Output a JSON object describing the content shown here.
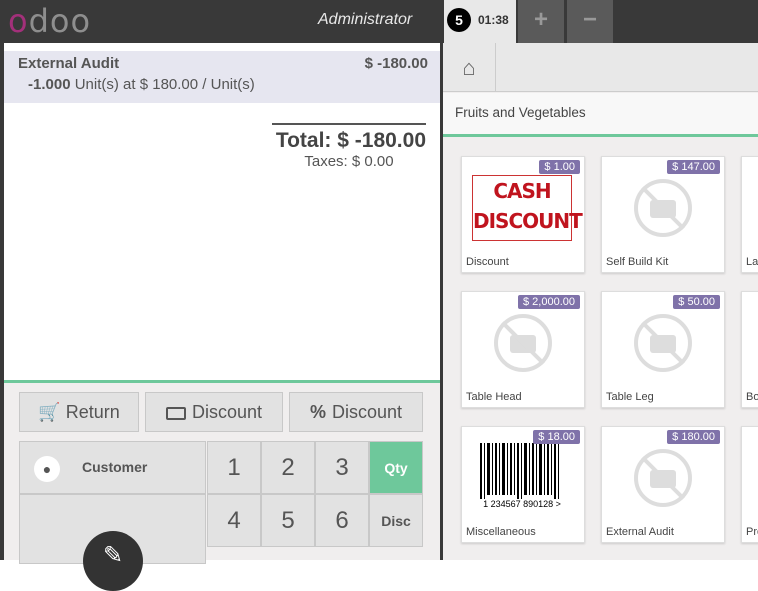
{
  "topbar": {
    "logo_text": "odoo",
    "user": "Administrator",
    "order_number": "5",
    "order_time": "01:38",
    "add_label": "+",
    "remove_label": "−"
  },
  "order": {
    "lines": [
      {
        "product": "External Audit",
        "price": "$ -180.00",
        "qty": "-1.000",
        "unit_info": "Unit(s) at $ 180.00 / Unit(s)"
      }
    ],
    "total": "Total: $ -180.00",
    "taxes": "Taxes: $ 0.00"
  },
  "controls": {
    "return_label": "Return",
    "discount_label": "Discount",
    "percent_discount_label": "Discount"
  },
  "pad": {
    "customer_label": "Customer",
    "keys": [
      "1",
      "2",
      "3",
      "Qty",
      "4",
      "5",
      "6",
      "Disc"
    ],
    "selected_mode": "Qty"
  },
  "category": {
    "current": "Fruits and Vegetables"
  },
  "products": [
    {
      "name": "Discount",
      "price": "$ 1.00",
      "image": "cash-discount",
      "image_text_1": "CASH",
      "image_text_2": "DISCOUNT"
    },
    {
      "name": "Self Build Kit",
      "price": "$ 147.00",
      "image": "no-image"
    },
    {
      "name": "Lap",
      "price": "",
      "image": "no-image"
    },
    {
      "name": "Table Head",
      "price": "$ 2,000.00",
      "image": "no-image"
    },
    {
      "name": "Table Leg",
      "price": "$ 50.00",
      "image": "no-image"
    },
    {
      "name": "Bo",
      "price": "",
      "image": "no-image"
    },
    {
      "name": "Miscellaneous",
      "price": "$ 18.00",
      "image": "barcode",
      "barcode_text": "1 234567 890128 >"
    },
    {
      "name": "External Audit",
      "price": "$ 180.00",
      "image": "no-image"
    },
    {
      "name": "Pro",
      "price": "",
      "image": "no-image"
    }
  ],
  "colors": {
    "topbar": "#393939",
    "accent_green": "#6ec89b",
    "price_tag": "#7f72a9",
    "logo_o": "#a3307a"
  }
}
